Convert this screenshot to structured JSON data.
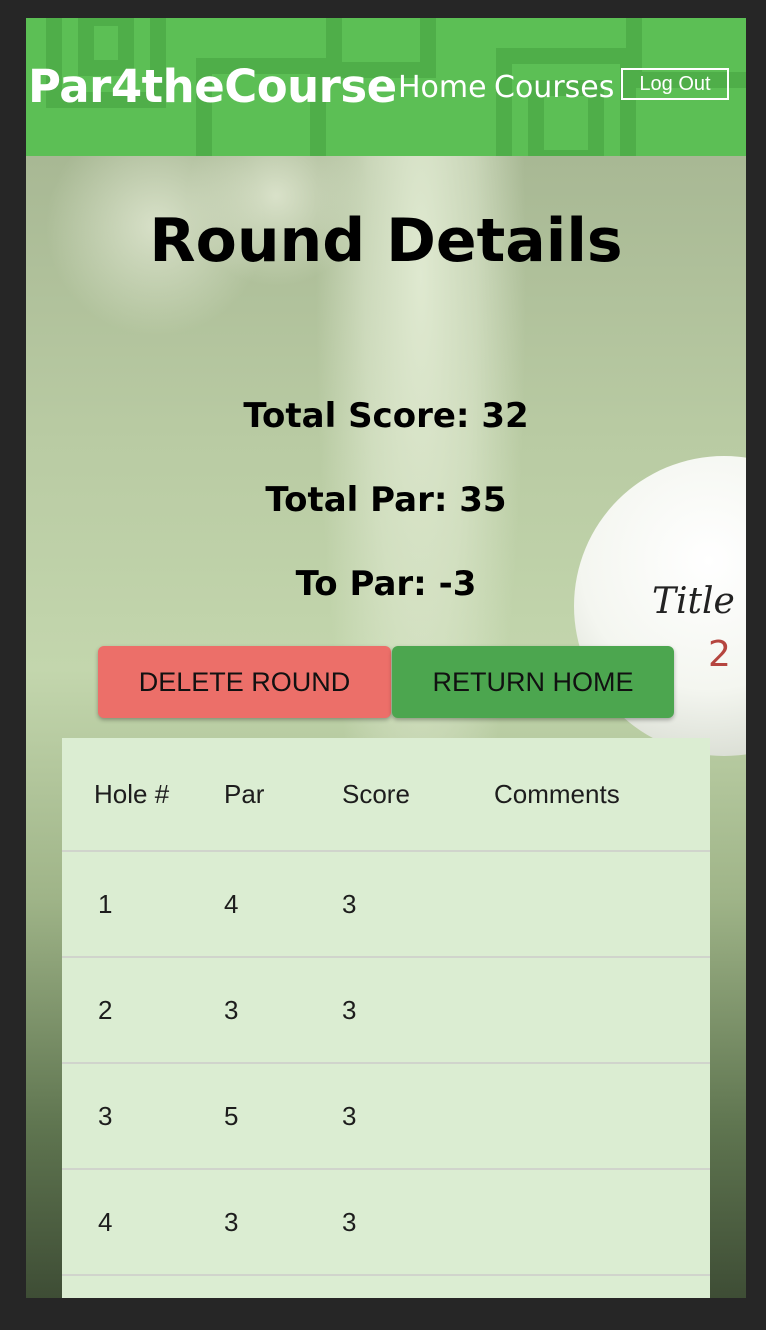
{
  "header": {
    "brand": "Par4theCourse",
    "nav": [
      "Home",
      "Courses"
    ],
    "logout_label": "Log Out"
  },
  "page": {
    "title": "Round Details",
    "total_score": "Total Score: 32",
    "total_par": "Total Par: 35",
    "to_par": "To Par: -3",
    "delete_label": "DELETE ROUND",
    "home_label": "RETURN HOME"
  },
  "ball": {
    "brand_text": "Title",
    "number": "2"
  },
  "table": {
    "headers": [
      "Hole #",
      "Par",
      "Score",
      "Comments"
    ],
    "rows": [
      [
        "1",
        "4",
        "3",
        ""
      ],
      [
        "2",
        "3",
        "3",
        ""
      ],
      [
        "3",
        "5",
        "3",
        ""
      ],
      [
        "4",
        "3",
        "3",
        ""
      ],
      [
        "",
        "",
        "",
        ""
      ]
    ]
  },
  "colors": {
    "header_green": "#5cbf55",
    "delete_red": "#ec6f69",
    "home_green": "#4ca64f",
    "table_bg": "#dbedd2"
  }
}
